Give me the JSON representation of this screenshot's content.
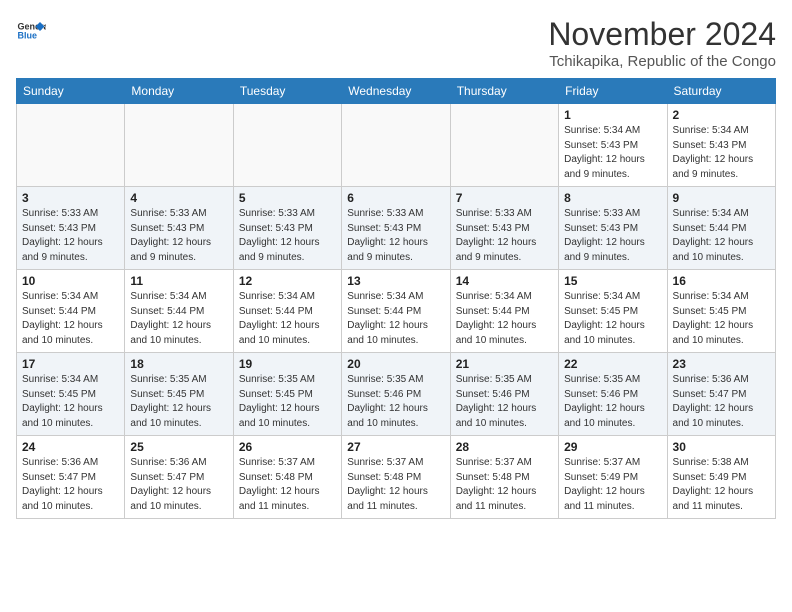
{
  "header": {
    "logo": {
      "general": "General",
      "blue": "Blue"
    },
    "title": "November 2024",
    "location": "Tchikapika, Republic of the Congo"
  },
  "calendar": {
    "weekdays": [
      "Sunday",
      "Monday",
      "Tuesday",
      "Wednesday",
      "Thursday",
      "Friday",
      "Saturday"
    ],
    "weeks": [
      [
        {
          "day": "",
          "info": ""
        },
        {
          "day": "",
          "info": ""
        },
        {
          "day": "",
          "info": ""
        },
        {
          "day": "",
          "info": ""
        },
        {
          "day": "",
          "info": ""
        },
        {
          "day": "1",
          "info": "Sunrise: 5:34 AM\nSunset: 5:43 PM\nDaylight: 12 hours and 9 minutes."
        },
        {
          "day": "2",
          "info": "Sunrise: 5:34 AM\nSunset: 5:43 PM\nDaylight: 12 hours and 9 minutes."
        }
      ],
      [
        {
          "day": "3",
          "info": "Sunrise: 5:33 AM\nSunset: 5:43 PM\nDaylight: 12 hours and 9 minutes."
        },
        {
          "day": "4",
          "info": "Sunrise: 5:33 AM\nSunset: 5:43 PM\nDaylight: 12 hours and 9 minutes."
        },
        {
          "day": "5",
          "info": "Sunrise: 5:33 AM\nSunset: 5:43 PM\nDaylight: 12 hours and 9 minutes."
        },
        {
          "day": "6",
          "info": "Sunrise: 5:33 AM\nSunset: 5:43 PM\nDaylight: 12 hours and 9 minutes."
        },
        {
          "day": "7",
          "info": "Sunrise: 5:33 AM\nSunset: 5:43 PM\nDaylight: 12 hours and 9 minutes."
        },
        {
          "day": "8",
          "info": "Sunrise: 5:33 AM\nSunset: 5:43 PM\nDaylight: 12 hours and 9 minutes."
        },
        {
          "day": "9",
          "info": "Sunrise: 5:34 AM\nSunset: 5:44 PM\nDaylight: 12 hours and 10 minutes."
        }
      ],
      [
        {
          "day": "10",
          "info": "Sunrise: 5:34 AM\nSunset: 5:44 PM\nDaylight: 12 hours and 10 minutes."
        },
        {
          "day": "11",
          "info": "Sunrise: 5:34 AM\nSunset: 5:44 PM\nDaylight: 12 hours and 10 minutes."
        },
        {
          "day": "12",
          "info": "Sunrise: 5:34 AM\nSunset: 5:44 PM\nDaylight: 12 hours and 10 minutes."
        },
        {
          "day": "13",
          "info": "Sunrise: 5:34 AM\nSunset: 5:44 PM\nDaylight: 12 hours and 10 minutes."
        },
        {
          "day": "14",
          "info": "Sunrise: 5:34 AM\nSunset: 5:44 PM\nDaylight: 12 hours and 10 minutes."
        },
        {
          "day": "15",
          "info": "Sunrise: 5:34 AM\nSunset: 5:45 PM\nDaylight: 12 hours and 10 minutes."
        },
        {
          "day": "16",
          "info": "Sunrise: 5:34 AM\nSunset: 5:45 PM\nDaylight: 12 hours and 10 minutes."
        }
      ],
      [
        {
          "day": "17",
          "info": "Sunrise: 5:34 AM\nSunset: 5:45 PM\nDaylight: 12 hours and 10 minutes."
        },
        {
          "day": "18",
          "info": "Sunrise: 5:35 AM\nSunset: 5:45 PM\nDaylight: 12 hours and 10 minutes."
        },
        {
          "day": "19",
          "info": "Sunrise: 5:35 AM\nSunset: 5:45 PM\nDaylight: 12 hours and 10 minutes."
        },
        {
          "day": "20",
          "info": "Sunrise: 5:35 AM\nSunset: 5:46 PM\nDaylight: 12 hours and 10 minutes."
        },
        {
          "day": "21",
          "info": "Sunrise: 5:35 AM\nSunset: 5:46 PM\nDaylight: 12 hours and 10 minutes."
        },
        {
          "day": "22",
          "info": "Sunrise: 5:35 AM\nSunset: 5:46 PM\nDaylight: 12 hours and 10 minutes."
        },
        {
          "day": "23",
          "info": "Sunrise: 5:36 AM\nSunset: 5:47 PM\nDaylight: 12 hours and 10 minutes."
        }
      ],
      [
        {
          "day": "24",
          "info": "Sunrise: 5:36 AM\nSunset: 5:47 PM\nDaylight: 12 hours and 10 minutes."
        },
        {
          "day": "25",
          "info": "Sunrise: 5:36 AM\nSunset: 5:47 PM\nDaylight: 12 hours and 10 minutes."
        },
        {
          "day": "26",
          "info": "Sunrise: 5:37 AM\nSunset: 5:48 PM\nDaylight: 12 hours and 11 minutes."
        },
        {
          "day": "27",
          "info": "Sunrise: 5:37 AM\nSunset: 5:48 PM\nDaylight: 12 hours and 11 minutes."
        },
        {
          "day": "28",
          "info": "Sunrise: 5:37 AM\nSunset: 5:48 PM\nDaylight: 12 hours and 11 minutes."
        },
        {
          "day": "29",
          "info": "Sunrise: 5:37 AM\nSunset: 5:49 PM\nDaylight: 12 hours and 11 minutes."
        },
        {
          "day": "30",
          "info": "Sunrise: 5:38 AM\nSunset: 5:49 PM\nDaylight: 12 hours and 11 minutes."
        }
      ]
    ]
  }
}
